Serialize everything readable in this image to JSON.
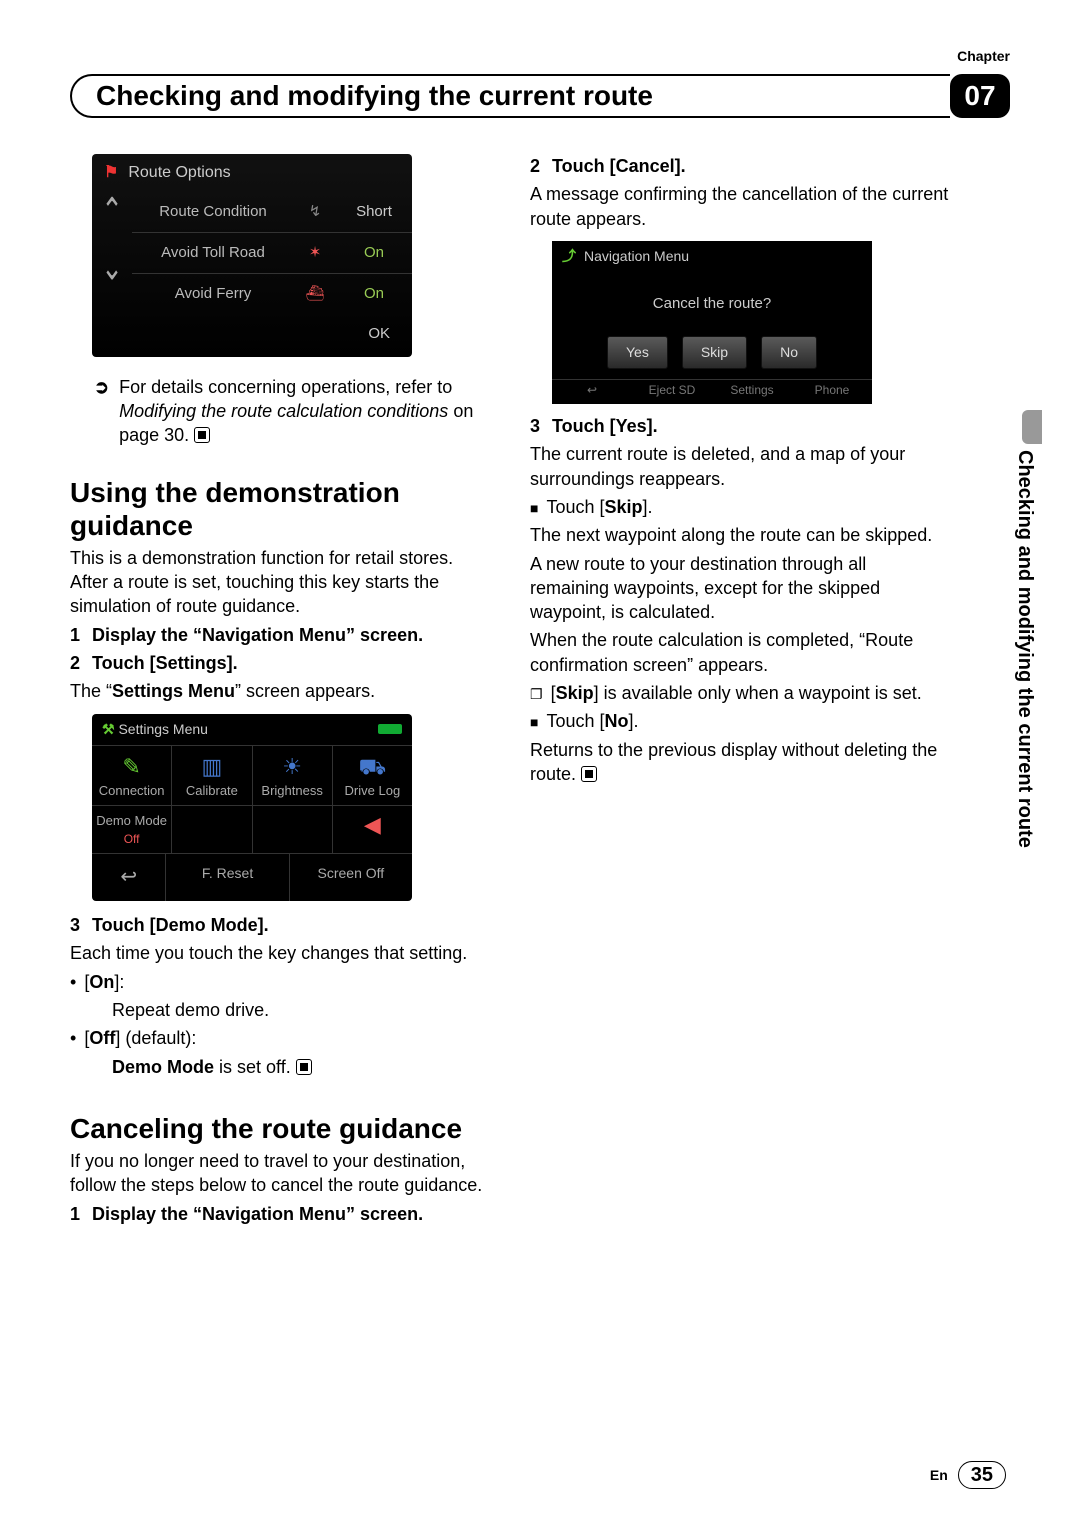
{
  "header": {
    "chapter_label": "Chapter",
    "title": "Checking and modifying the current route",
    "chapter_number": "07"
  },
  "side_tab": "Checking and modifying the current route",
  "footer": {
    "lang": "En",
    "page": "35"
  },
  "route_options": {
    "title": "Route Options",
    "rows": [
      {
        "label": "Route Condition",
        "value": "Short"
      },
      {
        "label": "Avoid Toll Road",
        "value": "On"
      },
      {
        "label": "Avoid Ferry",
        "value": "On"
      }
    ],
    "ok": "OK"
  },
  "ref_note": {
    "lead": "For details concerning operations, refer to",
    "em": "Modifying the route calculation conditions",
    "tail": "on page 30."
  },
  "demo": {
    "heading": "Using the demonstration guidance",
    "intro": "This is a demonstration function for retail stores. After a route is set, touching this key starts the simulation of route guidance.",
    "step1": "Display the “Navigation Menu” screen.",
    "step2": "Touch [Settings].",
    "step2_after_a": "The “",
    "step2_after_bold": "Settings Menu",
    "step2_after_b": "” screen appears.",
    "settings_title": "Settings Menu",
    "tiles": [
      "Connection",
      "Calibrate",
      "Brightness",
      "Drive Log"
    ],
    "demo_mode_label": "Demo Mode",
    "demo_mode_value": "Off",
    "freset": "F. Reset",
    "screen_off": "Screen Off",
    "step3": "Touch [Demo Mode].",
    "step3_body": "Each time you touch the key changes that setting.",
    "on_label": "On",
    "on_desc": "Repeat demo drive.",
    "off_label": "Off",
    "off_paren": " (default):",
    "off_desc_bold": "Demo Mode",
    "off_desc_tail": " is set off."
  },
  "cancel": {
    "heading": "Canceling the route guidance",
    "intro": "If you no longer need to travel to your destination, follow the steps below to cancel the route guidance.",
    "step1": "Display the “Navigation Menu” screen.",
    "step2": "Touch [Cancel].",
    "step2_body": "A message confirming the cancellation of the current route appears.",
    "nav_title": "Navigation Menu",
    "nav_msg": "Cancel the route?",
    "btn_yes": "Yes",
    "btn_skip": "Skip",
    "btn_no": "No",
    "tab_eject": "Eject SD",
    "tab_settings": "Settings",
    "tab_phone": "Phone",
    "step3": "Touch [Yes].",
    "step3_body": "The current route is deleted, and a map of your surroundings reappears.",
    "skip_label": "Skip",
    "skip_line": "].",
    "skip_body": "The next waypoint along the route can be skipped.",
    "skip_body2": "A new route to your destination through all remaining waypoints, except for the skipped waypoint, is calculated.",
    "skip_body3": "When the route calculation is completed, “Route confirmation screen” appears.",
    "skip_note_bold": "Skip",
    "skip_note_tail": "] is available only when a waypoint is set.",
    "no_label": "No",
    "no_body": "Returns to the previous display without deleting the route."
  }
}
